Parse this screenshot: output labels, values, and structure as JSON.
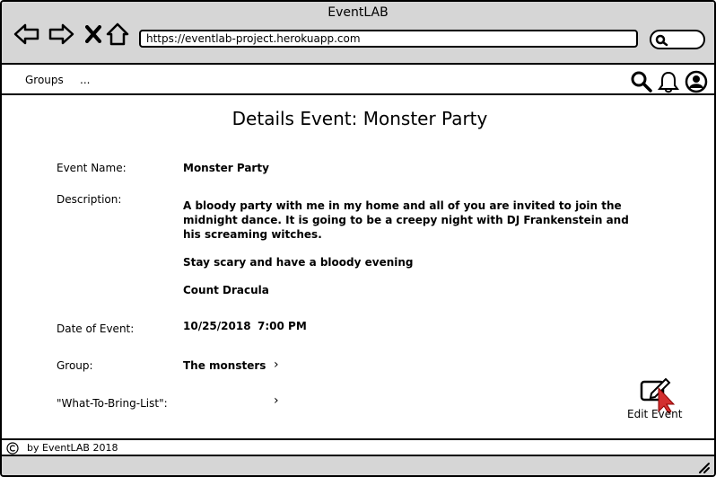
{
  "window": {
    "title": "EventLAB"
  },
  "browser": {
    "url": "https://eventlab-project.herokuapp.com",
    "icons": [
      "back-icon",
      "forward-icon",
      "close-icon",
      "home-icon",
      "search-icon"
    ]
  },
  "header": {
    "menu": [
      {
        "label": "Groups"
      },
      {
        "label": "..."
      }
    ],
    "icons": [
      "search-icon",
      "bell-icon",
      "user-icon"
    ]
  },
  "page": {
    "title": "Details Event: Monster Party",
    "fields": {
      "event_name": {
        "label": "Event Name:",
        "value": "Monster Party"
      },
      "description": {
        "label": "Description:",
        "paragraphs": [
          "A bloody party with me in my home and all of you are invited to join the midnight dance. It is going to be a creepy night with DJ Frankenstein and his screaming witches.",
          "Stay scary and have a bloody evening",
          "Count Dracula"
        ]
      },
      "date": {
        "label": "Date of Event:",
        "date": "10/25/2018",
        "time": "7:00 PM"
      },
      "group": {
        "label": "Group:",
        "value": "The monsters"
      },
      "bring_list": {
        "label": "\"What-To-Bring-List\":"
      }
    },
    "edit_button": {
      "label": "Edit Event",
      "icon": "edit-icon",
      "cursor_color": "#d32f2f"
    }
  },
  "footer": {
    "text": "by EventLAB 2018",
    "icon": "copyright-icon"
  }
}
